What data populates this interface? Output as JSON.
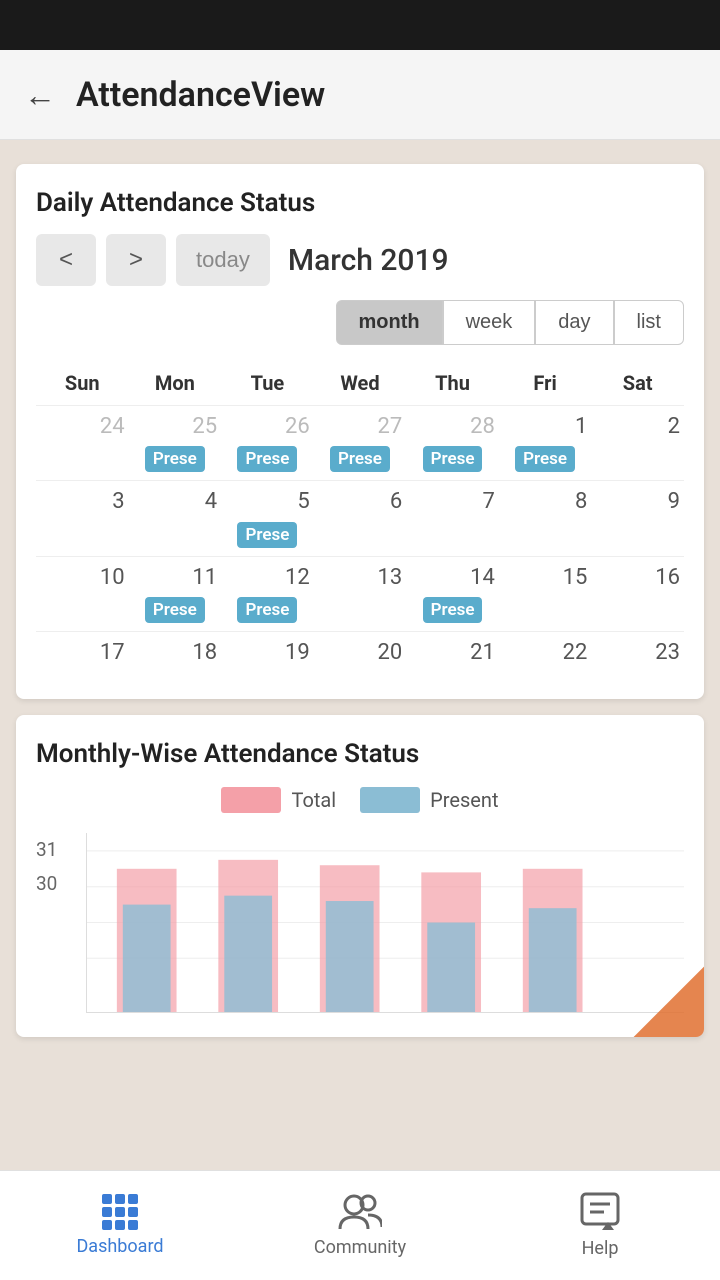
{
  "statusBar": {},
  "header": {
    "back": "←",
    "title": "AttendanceView"
  },
  "calendar": {
    "cardTitle": "Daily Attendance Status",
    "prevBtn": "<",
    "nextBtn": ">",
    "todayBtn": "today",
    "monthLabel": "March 2019",
    "toggleButtons": [
      "month",
      "week",
      "day",
      "list"
    ],
    "activeToggle": "month",
    "weekdays": [
      "Sun",
      "Mon",
      "Tue",
      "Wed",
      "Thu",
      "Fri",
      "Sat"
    ],
    "weeks": [
      [
        {
          "day": 24,
          "other": true,
          "badge": null
        },
        {
          "day": 25,
          "other": true,
          "badge": "Prese"
        },
        {
          "day": 26,
          "other": true,
          "badge": "Prese"
        },
        {
          "day": 27,
          "other": true,
          "badge": "Prese"
        },
        {
          "day": 28,
          "other": true,
          "badge": "Prese"
        },
        {
          "day": 1,
          "other": false,
          "badge": "Prese"
        },
        {
          "day": 2,
          "other": false,
          "badge": null
        }
      ],
      [
        {
          "day": 3,
          "other": false,
          "badge": null
        },
        {
          "day": 4,
          "other": false,
          "badge": null
        },
        {
          "day": 5,
          "other": false,
          "badge": "Prese"
        },
        {
          "day": 6,
          "other": false,
          "badge": null
        },
        {
          "day": 7,
          "other": false,
          "badge": null
        },
        {
          "day": 8,
          "other": false,
          "badge": null
        },
        {
          "day": 9,
          "other": false,
          "badge": null
        }
      ],
      [
        {
          "day": 10,
          "other": false,
          "badge": null
        },
        {
          "day": 11,
          "other": false,
          "badge": "Prese"
        },
        {
          "day": 12,
          "other": false,
          "badge": "Prese"
        },
        {
          "day": 13,
          "other": false,
          "badge": null
        },
        {
          "day": 14,
          "other": false,
          "badge": "Prese"
        },
        {
          "day": 15,
          "other": false,
          "badge": null
        },
        {
          "day": 16,
          "other": false,
          "badge": null
        }
      ],
      [
        {
          "day": 17,
          "other": false,
          "badge": null
        },
        {
          "day": 18,
          "other": false,
          "badge": null
        },
        {
          "day": 19,
          "other": false,
          "badge": null
        },
        {
          "day": 20,
          "other": false,
          "badge": null
        },
        {
          "day": 21,
          "other": false,
          "badge": null
        },
        {
          "day": 22,
          "other": false,
          "badge": null
        },
        {
          "day": 23,
          "other": false,
          "badge": null
        }
      ]
    ]
  },
  "monthly": {
    "cardTitle": "Monthly-Wise Attendance Status",
    "legend": [
      {
        "label": "Total",
        "type": "total"
      },
      {
        "label": "Present",
        "type": "present"
      }
    ],
    "yLabels": [
      "31",
      "30"
    ]
  },
  "bottomNav": {
    "items": [
      {
        "label": "Dashboard",
        "icon": "grid",
        "active": true
      },
      {
        "label": "Community",
        "icon": "community",
        "active": false
      },
      {
        "label": "Help",
        "icon": "help",
        "active": false
      }
    ]
  }
}
